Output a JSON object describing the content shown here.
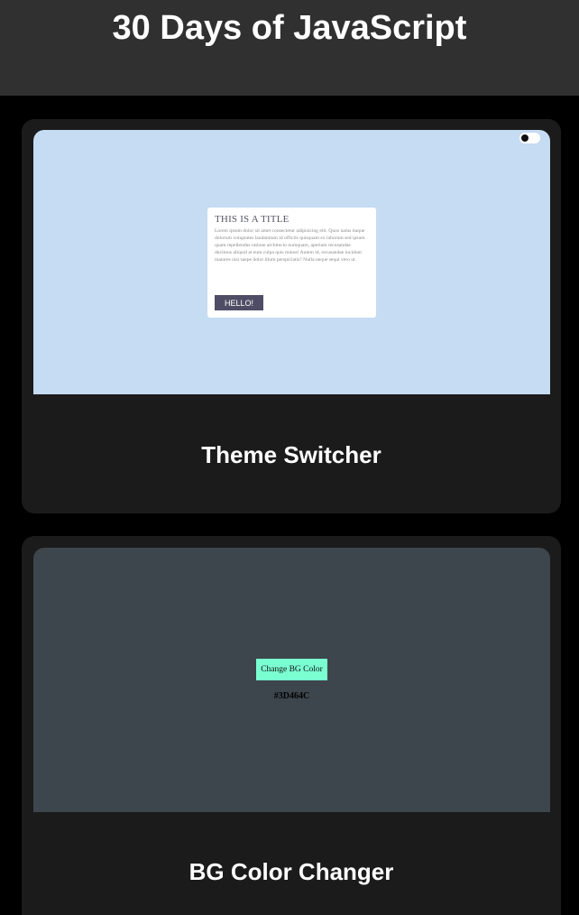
{
  "header": {
    "title": "30 Days of JavaScript"
  },
  "projects": [
    {
      "name": "Theme Switcher",
      "preview": {
        "background": "#c5dcf2",
        "toggle_icon": "toggle-switch-icon",
        "card": {
          "title": "THIS IS A TITLE",
          "text": "Lorem ipsum dolor sit amet consectetur adipisicing elit. Quos natus itaque dolorum voluptates laudantium id officiis quisquam ex laborum sed ipsum quam repellendus ratione architecto numquam, aperiam recusandae ducimus aliquid at eum culpa quis minus! Autem id, recusandae incidunt maiores nisi saepe dolor illum perspiciatis? Nulla neque sequi vero ut.",
          "button_label": "HELLO!"
        }
      }
    },
    {
      "name": "BG Color Changer",
      "preview": {
        "background": "#3d464c",
        "button_label": "Change BG Color",
        "button_color": "#7affd1",
        "color_code": "#3D464C"
      }
    }
  ]
}
